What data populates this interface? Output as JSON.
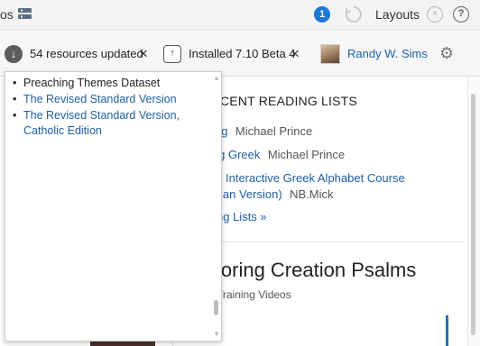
{
  "toolbar": {
    "left_fragment": "os",
    "badge_count": "1",
    "layouts_label": "Layouts",
    "close_icon_glyph": "×",
    "help_icon_glyph": "?"
  },
  "status_bar": {
    "resources_updated": "54 resources updated",
    "installed_version": "Installed 7.10 Beta 4",
    "user_name": "Randy W. Sims",
    "dismiss_glyph": "×"
  },
  "background": {
    "recent_lists_heading": "CENT READING LISTS",
    "reading_items": [
      {
        "title": "ng",
        "author": "Michael Prince"
      },
      {
        "title": "ing Greek",
        "author": "Michael Prince"
      },
      {
        "title": "Interactive Greek Alphabet Course",
        "author": ""
      },
      {
        "title": "ian Version)",
        "author": "NB.Mick"
      }
    ],
    "more_lists_link": "ng Lists »",
    "feature_title": "loring Creation Psalms",
    "feature_subtitle": "Training Videos"
  },
  "popup": {
    "items": [
      {
        "label": "Preaching Themes Dataset",
        "link": false
      },
      {
        "label": "The Revised Standard Version",
        "link": true
      },
      {
        "label": "The Revised Standard Version, Catholic Edition",
        "link": true
      }
    ]
  },
  "colors": {
    "link": "#1f5fa6",
    "badge": "#1e78d8"
  }
}
